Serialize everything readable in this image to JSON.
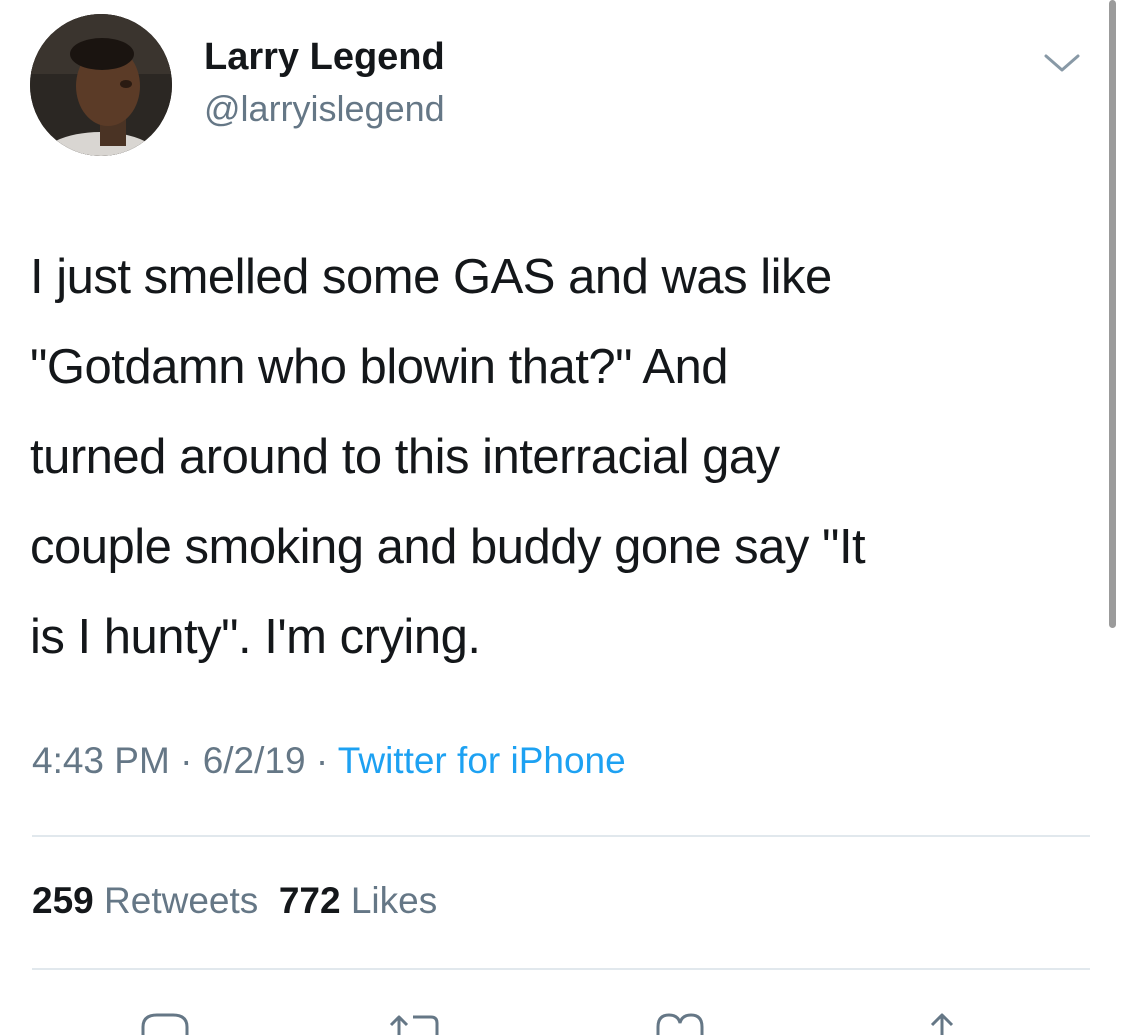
{
  "user": {
    "display_name": "Larry Legend",
    "handle": "@larryislegend"
  },
  "tweet": {
    "lines": [
      "I just smelled some GAS and was like",
      "\"Gotdamn who blowin that?\" And",
      "turned around to this interracial gay",
      "couple smoking and buddy gone say \"It",
      "is I hunty\". I'm crying."
    ],
    "time": "4:43 PM",
    "date": "6/2/19",
    "separator": "·",
    "source": "Twitter for iPhone"
  },
  "stats": {
    "retweets_count": "259",
    "retweets_label": "Retweets",
    "likes_count": "772",
    "likes_label": "Likes"
  },
  "icons": {
    "menu": "chevron-down-icon",
    "reply": "reply-icon",
    "retweet": "retweet-icon",
    "like": "heart-icon",
    "share": "share-icon"
  },
  "colors": {
    "text": "#14171a",
    "secondary": "#657786",
    "link": "#1da1f2",
    "divider": "#e1e8ed"
  }
}
